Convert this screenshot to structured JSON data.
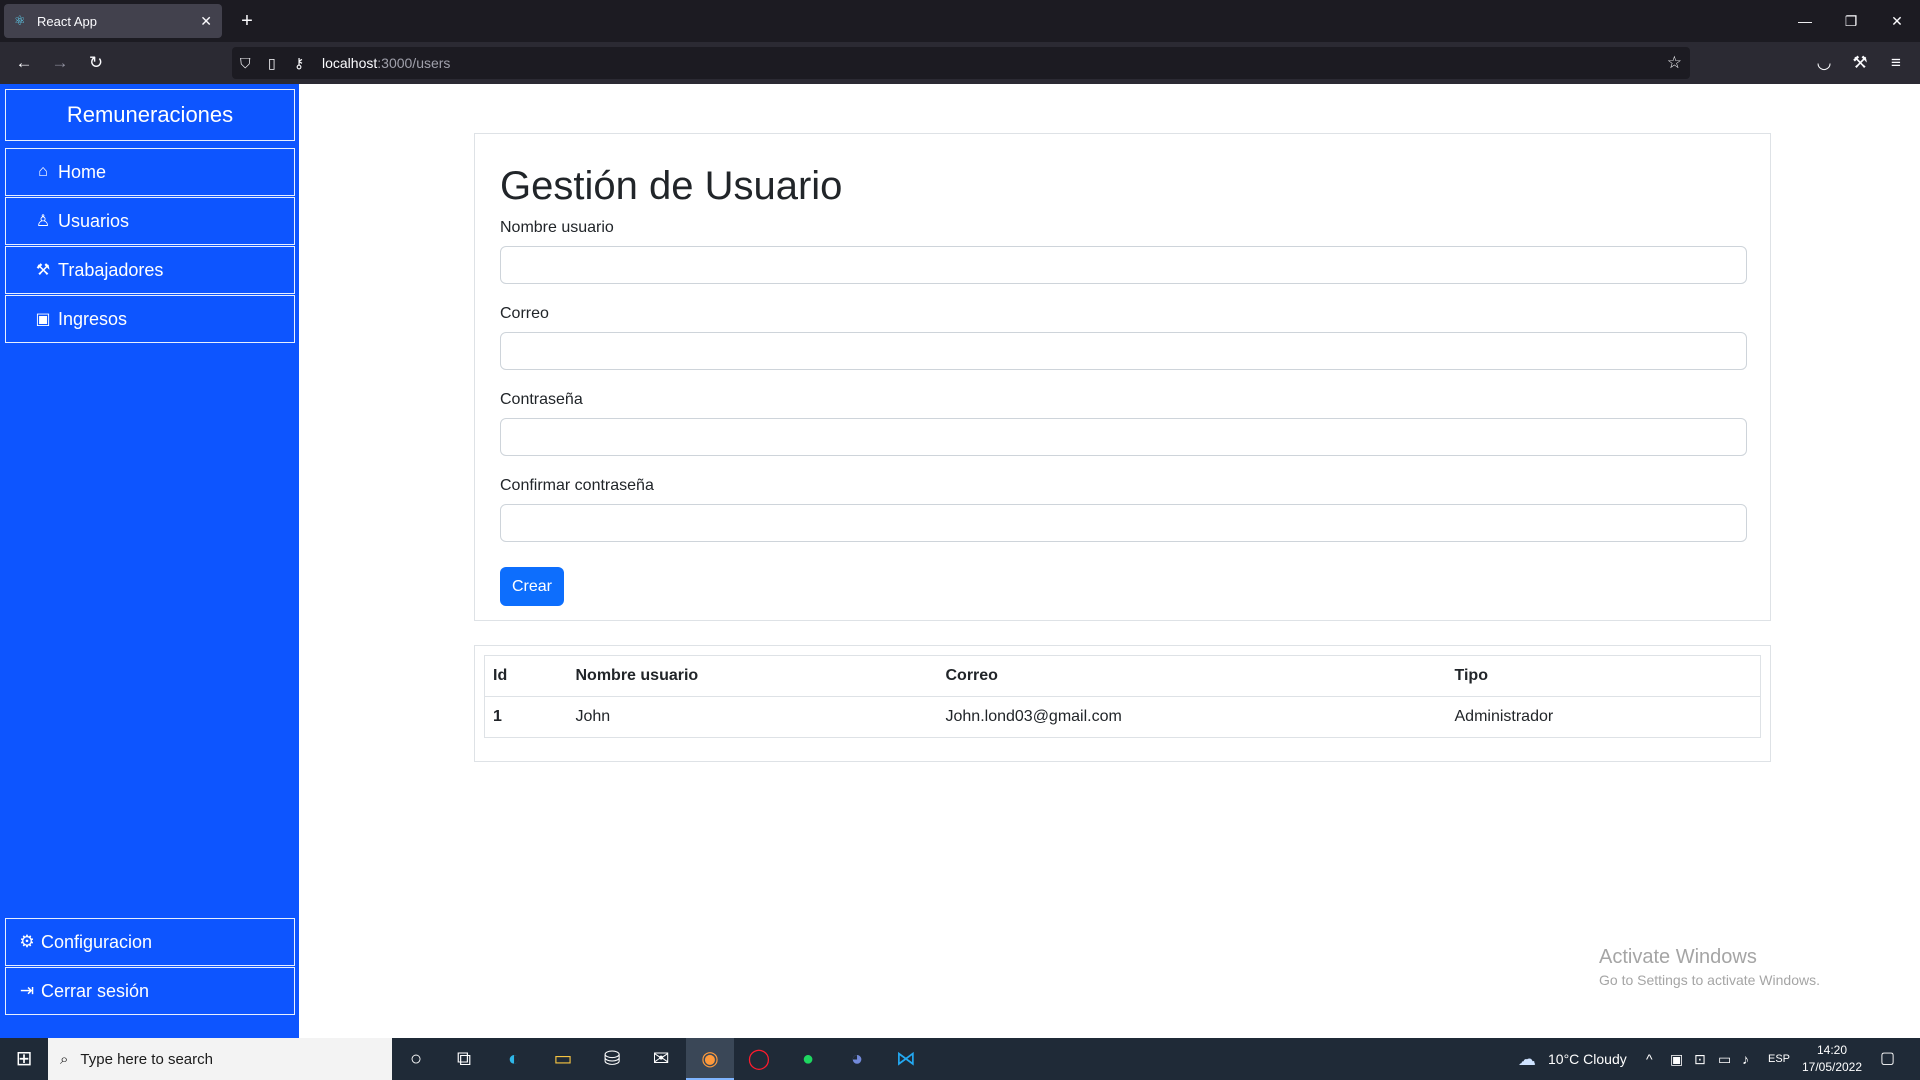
{
  "browser": {
    "tab_title": "React App",
    "url_host": "localhost",
    "url_path": ":3000/users"
  },
  "sidebar": {
    "brand": "Remuneraciones",
    "items": [
      {
        "label": "Home",
        "icon": "home-icon"
      },
      {
        "label": "Usuarios",
        "icon": "person-icon"
      },
      {
        "label": "Trabajadores",
        "icon": "hammer-icon"
      },
      {
        "label": "Ingresos",
        "icon": "cash-icon"
      }
    ],
    "bottom_items": [
      {
        "label": "Configuracion",
        "icon": "gear-icon"
      },
      {
        "label": "Cerrar sesión",
        "icon": "logout-icon"
      }
    ]
  },
  "form": {
    "title": "Gestión de Usuario",
    "fields": [
      {
        "label": "Nombre usuario",
        "value": ""
      },
      {
        "label": "Correo",
        "value": ""
      },
      {
        "label": "Contraseña",
        "value": ""
      },
      {
        "label": "Confirmar contraseña",
        "value": ""
      }
    ],
    "submit_label": "Crear"
  },
  "table": {
    "headers": [
      "Id",
      "Nombre usuario",
      "Correo",
      "Tipo"
    ],
    "rows": [
      [
        "1",
        "John",
        "John.lond03@gmail.com",
        "Administrador"
      ]
    ]
  },
  "watermark": {
    "line1": "Activate Windows",
    "line2": "Go to Settings to activate Windows."
  },
  "taskbar": {
    "search_placeholder": "Type here to search",
    "weather": "10°C  Cloudy",
    "language": "ESP",
    "time": "14:20",
    "date": "17/05/2022"
  },
  "colors": {
    "sidebar": "#0d55ff",
    "primary_button": "#0d6efd"
  }
}
